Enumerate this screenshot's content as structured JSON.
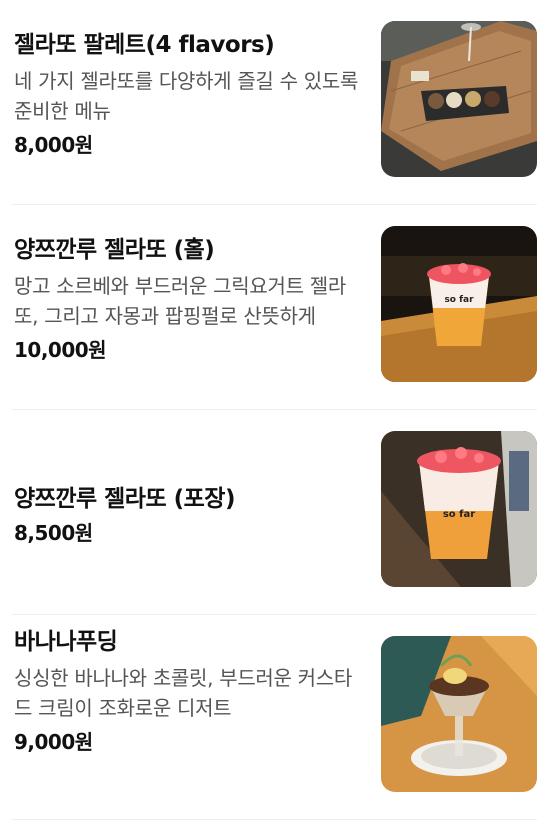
{
  "menu": {
    "items": [
      {
        "name": "젤라또 팔레트(4 flavors)",
        "description": "네 가지 젤라또를 다양하게 즐길 수 있도록 준비한 메뉴",
        "price": "8,000원",
        "image": "gelato-palette-photo"
      },
      {
        "name": "양쯔깐루 젤라또 (홀)",
        "description": "망고 소르베와 부드러운 그릭요거트 젤라또, 그리고 자몽과 팝핑펄로 산뜻하게",
        "price": "10,000원",
        "image": "mango-gelato-cup-photo",
        "cup_brand": "so far"
      },
      {
        "name": "양쯔깐루 젤라또 (포장)",
        "description": "",
        "price": "8,500원",
        "image": "mango-gelato-takeout-photo",
        "cup_brand": "so far"
      },
      {
        "name": "바나나푸딩",
        "description": "싱싱한 바나나와 초콜릿, 부드러운 커스타드 크림이 조화로운 디저트",
        "price": "9,000원",
        "image": "banana-pudding-photo"
      }
    ]
  }
}
